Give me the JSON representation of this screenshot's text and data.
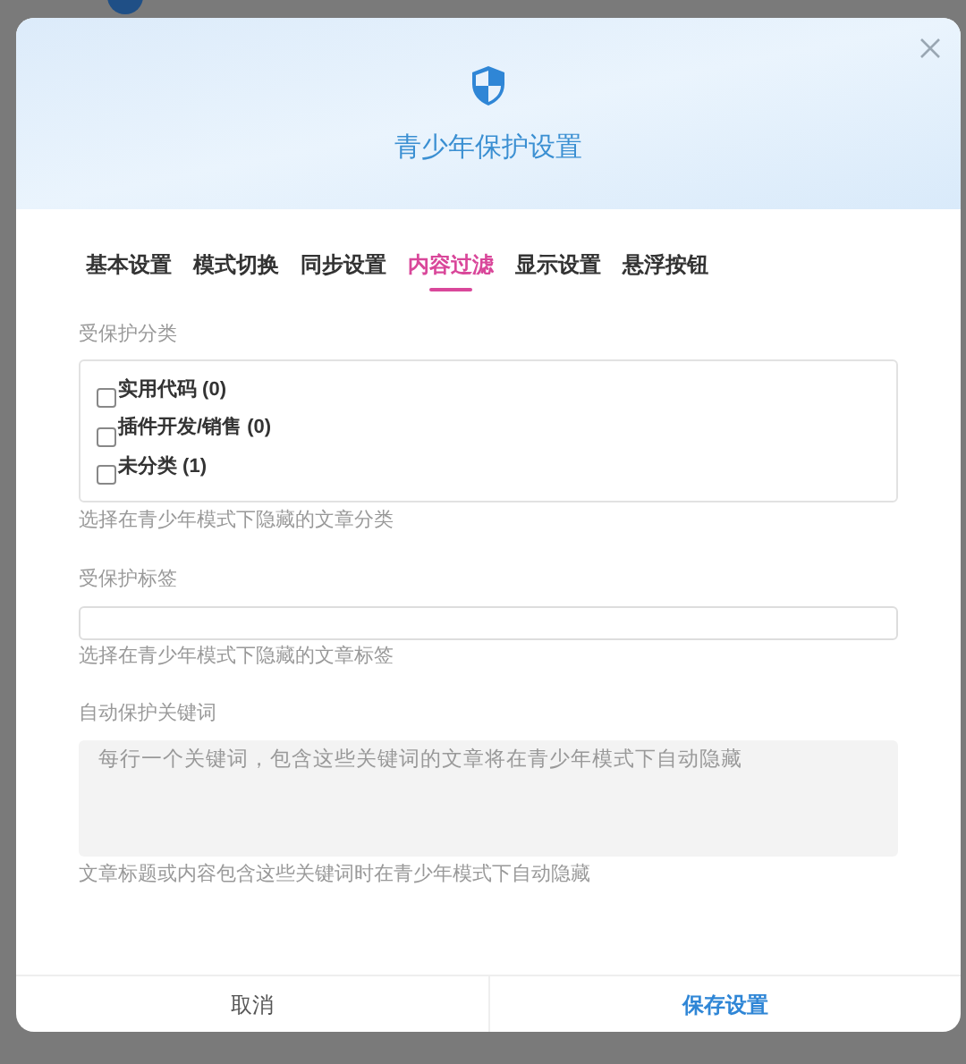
{
  "dialog": {
    "title": "青少年保护设置"
  },
  "tabs": [
    {
      "label": "基本设置",
      "selected": false
    },
    {
      "label": "模式切换",
      "selected": false
    },
    {
      "label": "同步设置",
      "selected": false
    },
    {
      "label": "内容过滤",
      "selected": true
    },
    {
      "label": "显示设置",
      "selected": false
    },
    {
      "label": "悬浮按钮",
      "selected": false
    }
  ],
  "categories": {
    "label": "受保护分类",
    "hint": "选择在青少年模式下隐藏的文章分类",
    "items": [
      {
        "label": "实用代码 (0)",
        "checked": false
      },
      {
        "label": "插件开发/销售 (0)",
        "checked": false
      },
      {
        "label": "未分类 (1)",
        "checked": false
      }
    ]
  },
  "tags": {
    "label": "受保护标签",
    "hint": "选择在青少年模式下隐藏的文章标签"
  },
  "keywords": {
    "label": "自动保护关键词",
    "placeholder": "每行一个关键词，包含这些关键词的文章将在青少年模式下自动隐藏",
    "hint": "文章标题或内容包含这些关键词时在青少年模式下自动隐藏"
  },
  "buttons": [
    {
      "label": "取消",
      "kind": "cancel"
    },
    {
      "label": "保存设置",
      "kind": "primary"
    }
  ]
}
